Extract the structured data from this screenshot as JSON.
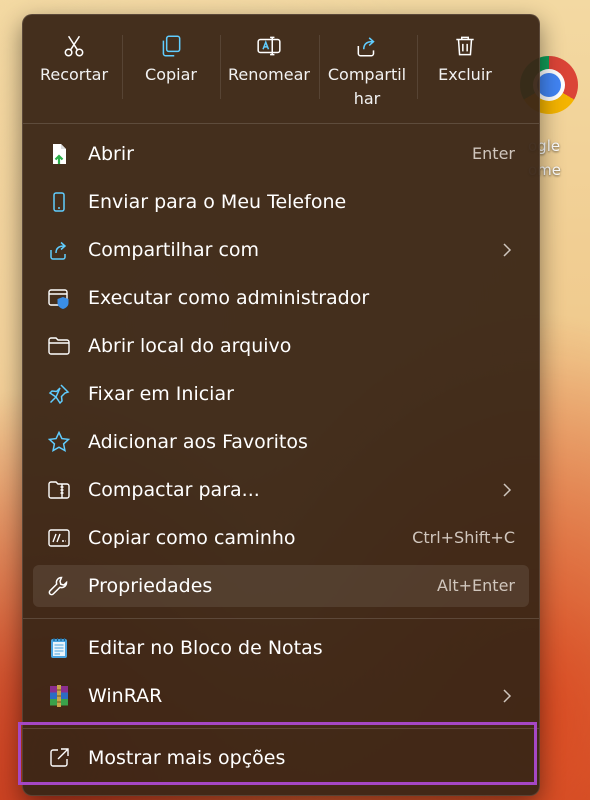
{
  "desktop": {
    "chrome_label": "ogle\nome"
  },
  "toolbar": {
    "cut": "Recortar",
    "copy": "Copiar",
    "rename": "Renomear",
    "share": "Compartil\nhar",
    "delete": "Excluir"
  },
  "items": [
    {
      "label": "Abrir",
      "shortcut": "Enter"
    },
    {
      "label": "Enviar para o Meu Telefone"
    },
    {
      "label": "Compartilhar com"
    },
    {
      "label": "Executar como administrador"
    },
    {
      "label": "Abrir local do arquivo"
    },
    {
      "label": "Fixar em Iniciar"
    },
    {
      "label": "Adicionar aos Favoritos"
    },
    {
      "label": "Compactar para..."
    },
    {
      "label": "Copiar como caminho",
      "shortcut": "Ctrl+Shift+C"
    },
    {
      "label": "Propriedades",
      "shortcut": "Alt+Enter"
    },
    {
      "label": "Editar no Bloco de Notas"
    },
    {
      "label": "WinRAR"
    },
    {
      "label": "Mostrar mais opções"
    }
  ],
  "colors": {
    "accent": "#60cdff",
    "highlight": "#a547c4"
  }
}
